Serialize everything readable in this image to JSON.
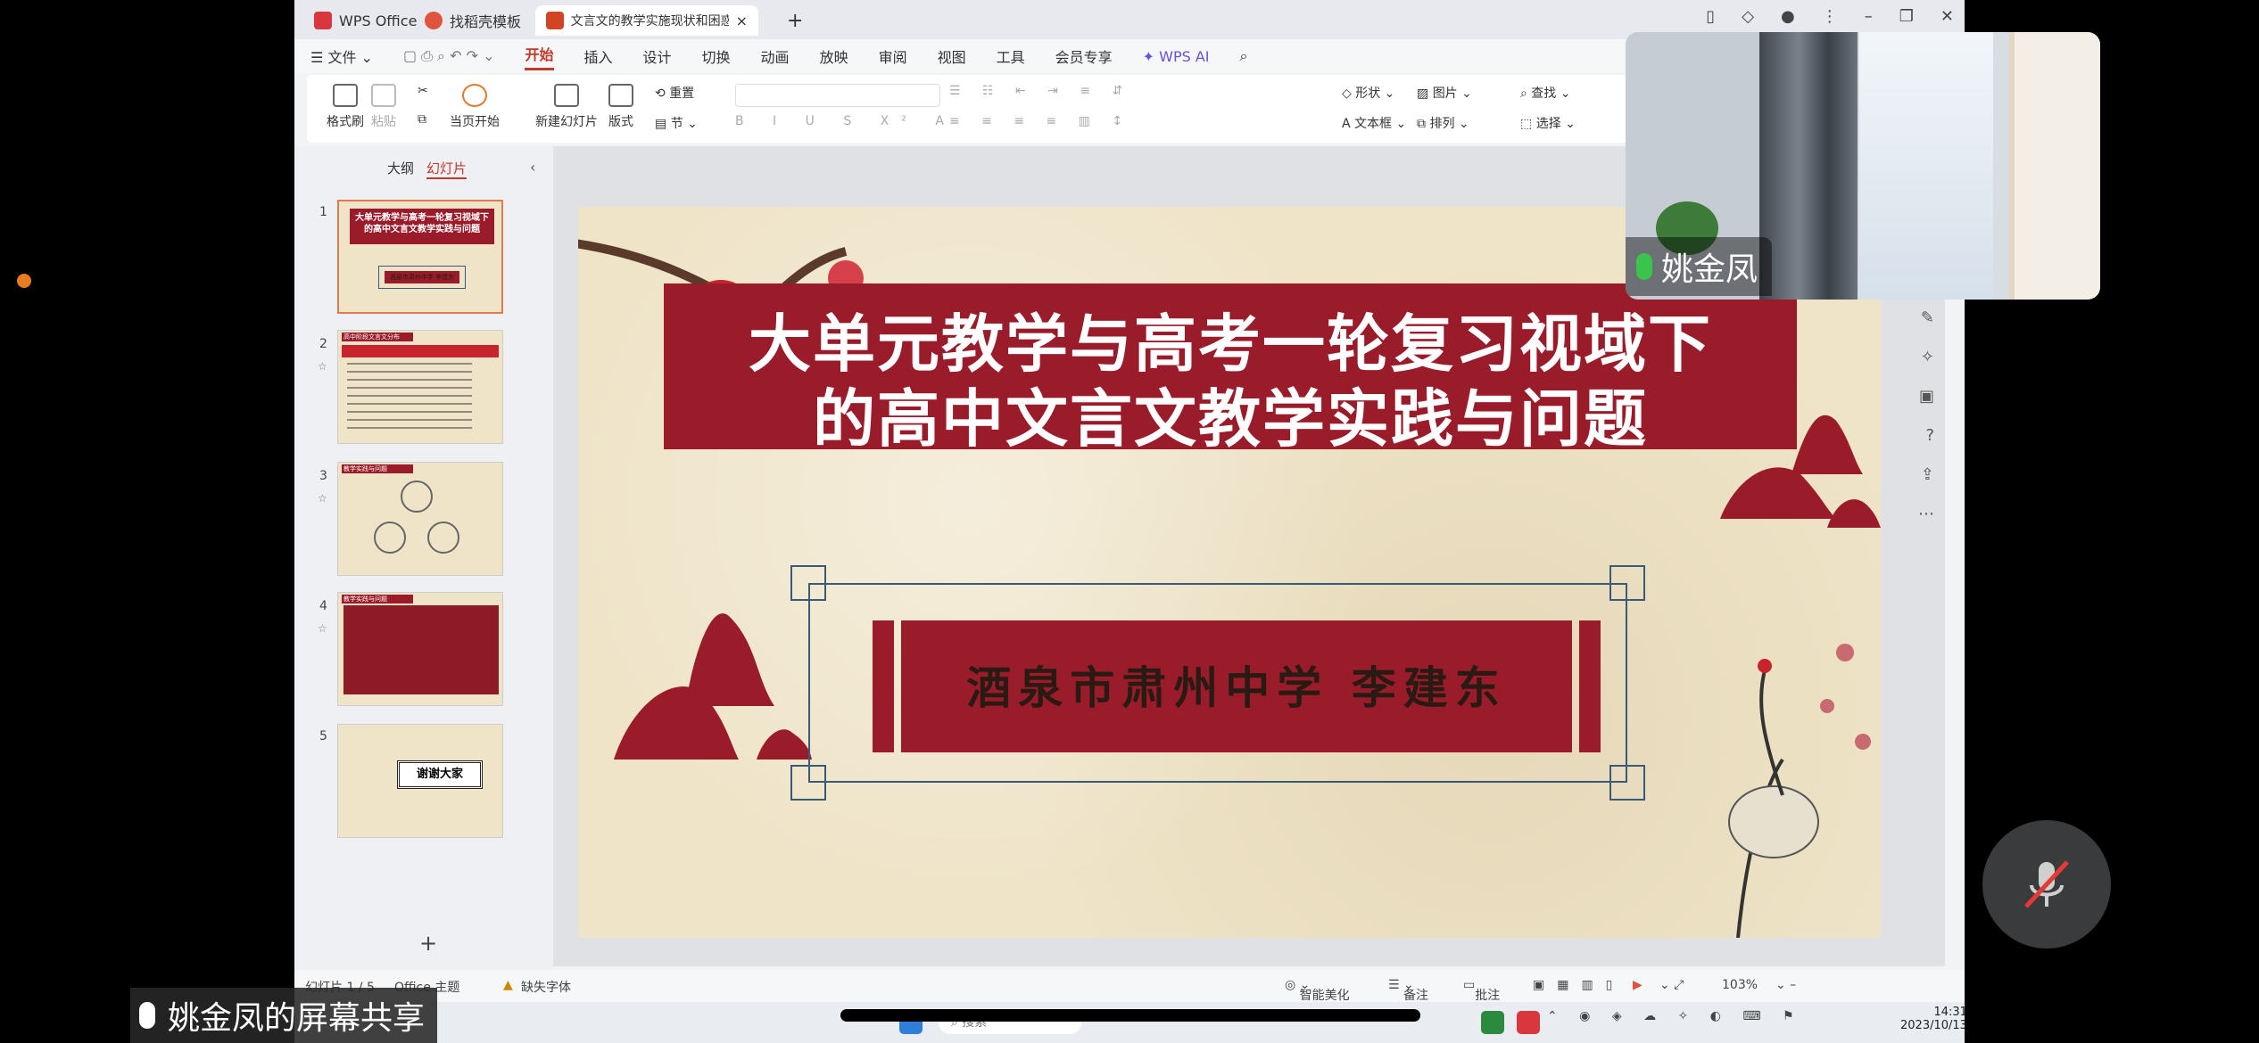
{
  "tabs": [
    {
      "label": "WPS Office",
      "color": "#d9363e"
    },
    {
      "label": "找稻壳模板",
      "color": "#e0533d"
    },
    {
      "label": "文言文的教学实施现状和困惑",
      "color": "#d14424"
    }
  ],
  "menu": [
    "文件",
    "开始",
    "插入",
    "设计",
    "切换",
    "动画",
    "放映",
    "审阅",
    "视图",
    "工具",
    "会员专享",
    "WPS AI"
  ],
  "ribbon": {
    "format_painter": "格式刷",
    "paste": "粘贴",
    "from_current": "当页开始",
    "new_slide": "新建幻灯片",
    "layout": "版式",
    "section": "节",
    "reset": "重置",
    "shape": "形状",
    "picture": "图片",
    "find": "查找",
    "textbox": "文本框",
    "arrange": "排列",
    "select": "选择"
  },
  "side_tabs": {
    "outline": "大纲",
    "slides": "幻灯片"
  },
  "thumbnails": [
    {
      "num": "1",
      "title": "大单元教学与高考一轮复习视域下的高中文言文教学实践与问题",
      "sub": "酒泉市肃州中学 李建东"
    },
    {
      "num": "2",
      "title": "高中阶段文言文分布"
    },
    {
      "num": "3",
      "title": "教学实践与问题"
    },
    {
      "num": "4",
      "title": "教学实践与问题"
    },
    {
      "num": "5",
      "title": "谢谢大家"
    }
  ],
  "slide": {
    "title_line1": "大单元教学与高考一轮复习视域下",
    "title_line2": "的高中文言文教学实践与问题",
    "author": "酒泉市肃州中学  李建东",
    "accent": "#9a1c2a"
  },
  "status": {
    "slide_count": "幻灯片 1 / 5",
    "theme": "Office 主题",
    "missing_font": "缺失字体",
    "beautify": "智能美化",
    "notes": "备注",
    "comments": "批注",
    "zoom": "103%"
  },
  "taskbar": {
    "search": "搜索",
    "time": "14:31",
    "date": "2023/10/13"
  },
  "video": {
    "participant": "姚金凤"
  },
  "share_label": "姚金凤的屏幕共享",
  "add_slide": "+"
}
